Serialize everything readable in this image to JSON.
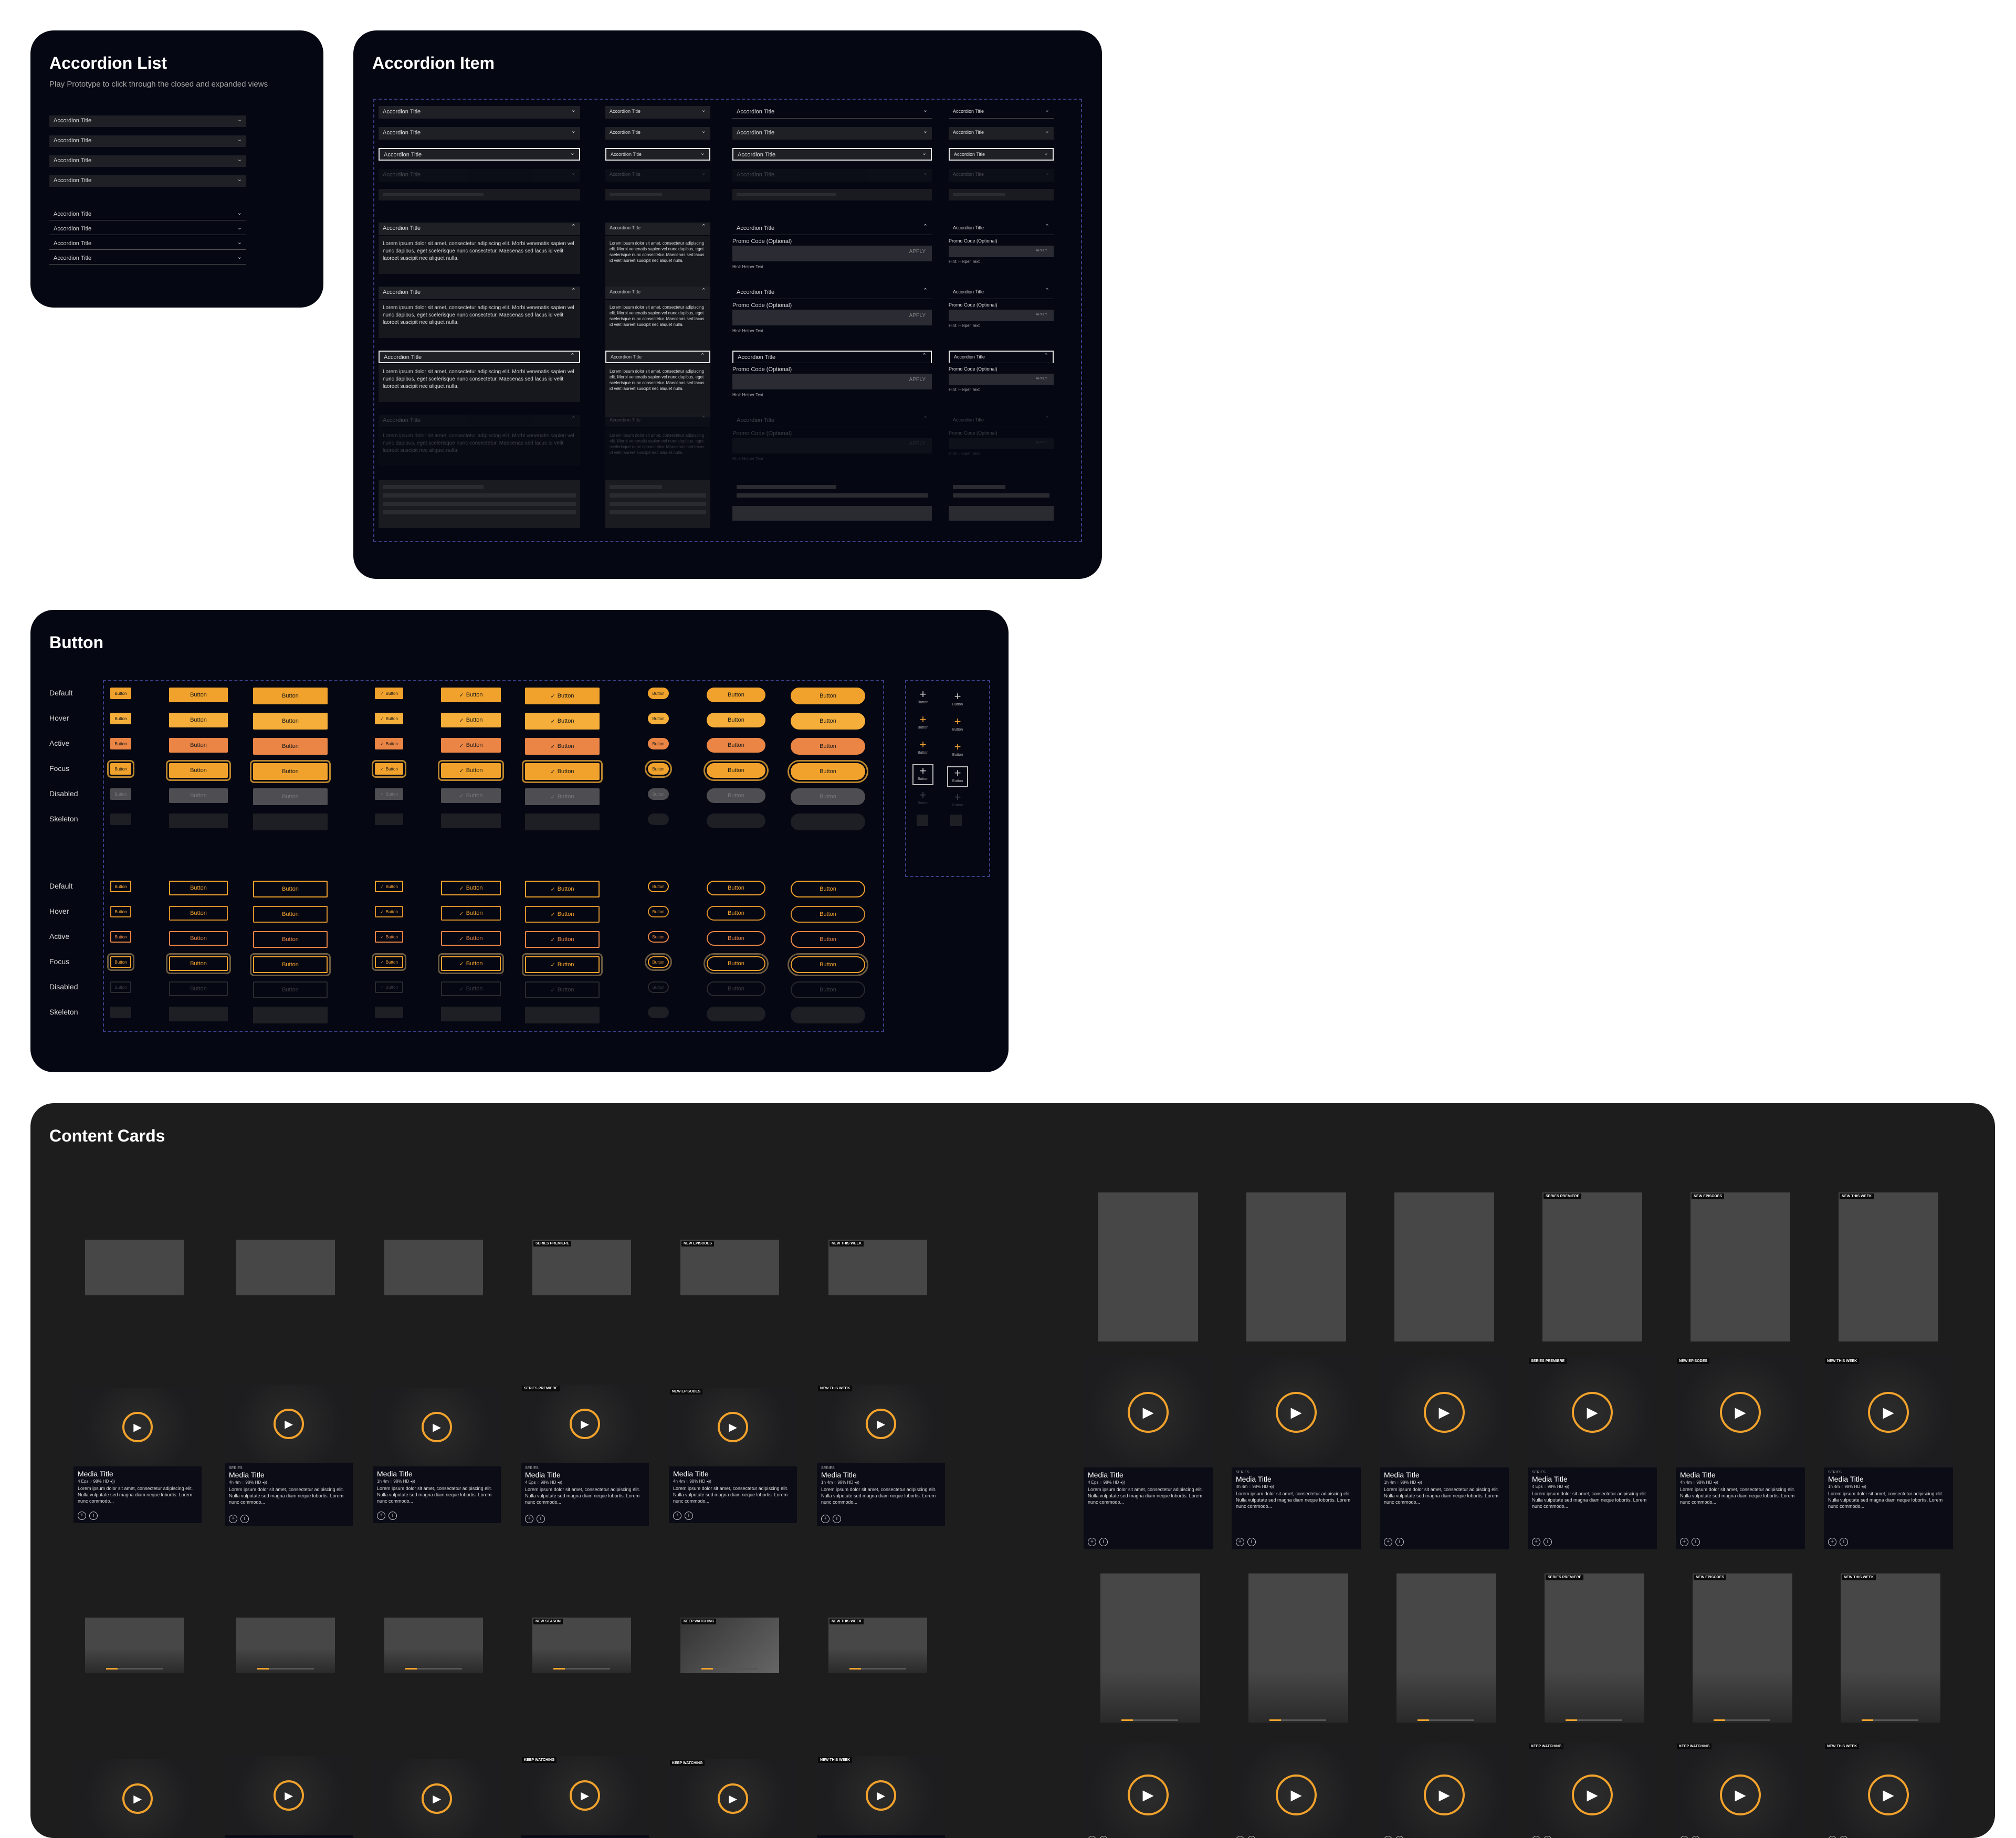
{
  "accordion_list": {
    "title": "Accordion List",
    "subtitle": "Play Prototype to click through the closed and expanded views",
    "item_label": "Accordion Title"
  },
  "accordion_item": {
    "title": "Accordion Item",
    "item_label": "Accordion Title",
    "body_text": "Lorem ipsum dolor sit amet, consectetur adipiscing elit. Morbi venenatis sapien vel nunc dapibus, eget scelerisque nunc consectetur. Maecenas sed lacus id velit laoreet suscipit nec aliquet nulla.",
    "promo_label": "Promo Code (Optional)",
    "apply_label": "APPLY",
    "helper_text": "Hint: Helper Text"
  },
  "button_section": {
    "title": "Button",
    "button_label": "Button",
    "states": [
      "Default",
      "Hover",
      "Active",
      "Focus",
      "Disabled",
      "Skeleton"
    ],
    "icon_plus": "+"
  },
  "content_cards": {
    "title": "Content Cards",
    "badges": {
      "series_premiere": "SERIES PREMIERE",
      "new_episodes": "NEW EPISODES",
      "new_this_week": "NEW THIS WEEK",
      "new_season": "NEW SEASON",
      "keep_watching": "KEEP WATCHING"
    },
    "media_title": "Media Title",
    "series_label": "SERIES",
    "meta_a": "4 Eps  ◌ 98%  HD  ◂))",
    "meta_b": "1h 4m  ◌ 98%  HD  ◂))",
    "meta_c": "4h 4m  ◌ 98%  HD  ◂))",
    "description": "Lorem ipsum dolor sit amet, consectetur adipiscing elit. Nulla vulputate sed magna diam neque lobortis. Lorem nunc commodo...",
    "add_icon": "+",
    "info_icon": "i",
    "play_icon": "▶",
    "progress": 0.2
  },
  "colors": {
    "panel_bg": "#050712",
    "cards_bg": "#1d1d1d",
    "accent": "#f1a22c",
    "active": "#ea8545"
  }
}
